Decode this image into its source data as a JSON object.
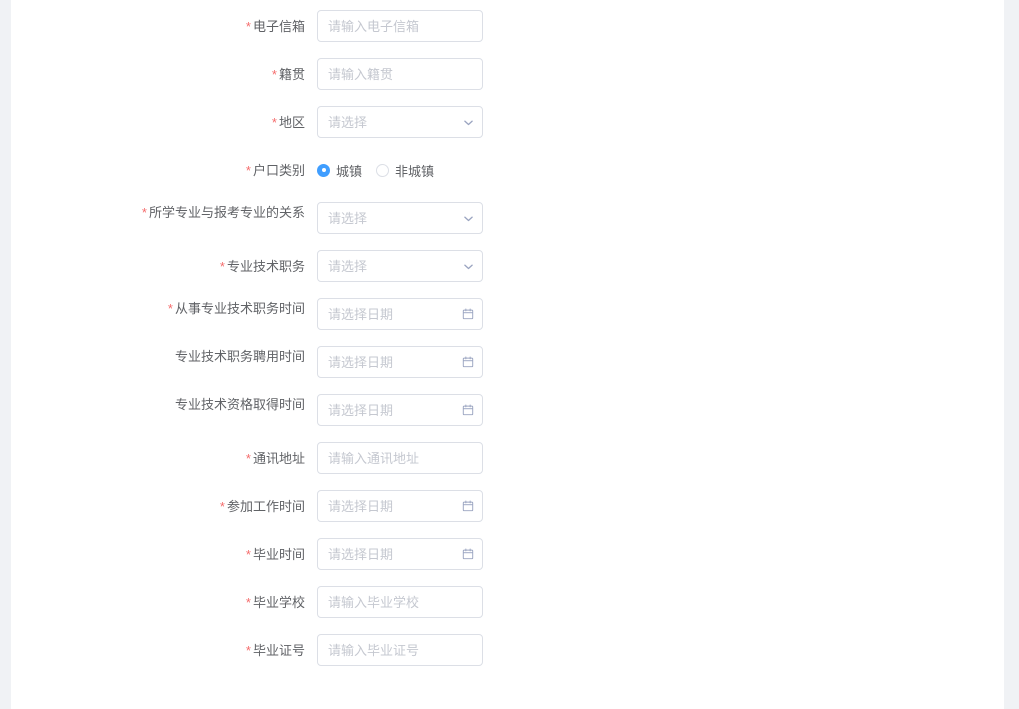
{
  "colors": {
    "page_background": "#f0f2f5",
    "card_background": "#ffffff",
    "label_text": "#606266",
    "placeholder_text": "#c5c8d0",
    "border": "#dcdfe6",
    "required_star": "#f56c6c",
    "accent": "#409eff"
  },
  "form": {
    "rows": [
      {
        "label": "电子信箱",
        "required": true,
        "type": "text",
        "placeholder": "请输入电子信箱",
        "value": "",
        "icon": null
      },
      {
        "label": "籍贯",
        "required": true,
        "type": "text",
        "placeholder": "请输入籍贯",
        "value": "",
        "icon": null
      },
      {
        "label": "地区",
        "required": true,
        "type": "select",
        "placeholder": "请选择",
        "value": "",
        "icon": "chevron-down-icon"
      },
      {
        "label": "户口类别",
        "required": true,
        "type": "radio",
        "placeholder": "",
        "value": "城镇",
        "options": [
          "城镇",
          "非城镇"
        ],
        "icon": null
      },
      {
        "label": "所学专业与报考专业的关系",
        "required": true,
        "type": "select",
        "placeholder": "请选择",
        "value": "",
        "icon": "chevron-down-icon"
      },
      {
        "label": "专业技术职务",
        "required": true,
        "type": "select",
        "placeholder": "请选择",
        "value": "",
        "icon": "chevron-down-icon"
      },
      {
        "label": "从事专业技术职务时间",
        "required": true,
        "type": "date",
        "placeholder": "请选择日期",
        "value": "",
        "icon": "calendar-icon"
      },
      {
        "label": "专业技术职务聘用时间",
        "required": false,
        "type": "date",
        "placeholder": "请选择日期",
        "value": "",
        "icon": "calendar-icon"
      },
      {
        "label": "专业技术资格取得时间",
        "required": false,
        "type": "date",
        "placeholder": "请选择日期",
        "value": "",
        "icon": "calendar-icon"
      },
      {
        "label": "通讯地址",
        "required": true,
        "type": "text",
        "placeholder": "请输入通讯地址",
        "value": "",
        "icon": null
      },
      {
        "label": "参加工作时间",
        "required": true,
        "type": "date",
        "placeholder": "请选择日期",
        "value": "",
        "icon": "calendar-icon"
      },
      {
        "label": "毕业时间",
        "required": true,
        "type": "date",
        "placeholder": "请选择日期",
        "value": "",
        "icon": "calendar-icon"
      },
      {
        "label": "毕业学校",
        "required": true,
        "type": "text",
        "placeholder": "请输入毕业学校",
        "value": "",
        "icon": null
      },
      {
        "label": "毕业证号",
        "required": true,
        "type": "text",
        "placeholder": "请输入毕业证号",
        "value": "",
        "icon": null
      }
    ]
  }
}
